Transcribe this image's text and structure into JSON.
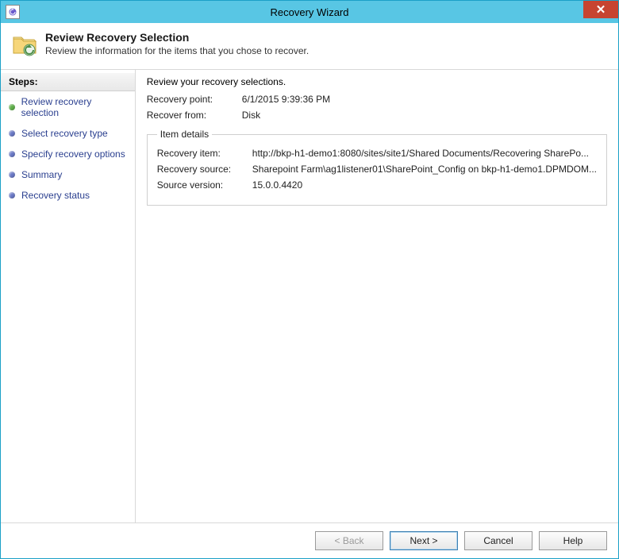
{
  "window": {
    "title": "Recovery Wizard"
  },
  "header": {
    "title": "Review Recovery Selection",
    "subtitle": "Review the information for the items that you chose to recover."
  },
  "sidebar": {
    "title": "Steps:",
    "steps": [
      {
        "label": "Review recovery selection",
        "current": true
      },
      {
        "label": "Select recovery type",
        "current": false
      },
      {
        "label": "Specify recovery options",
        "current": false
      },
      {
        "label": "Summary",
        "current": false
      },
      {
        "label": "Recovery status",
        "current": false
      }
    ]
  },
  "content": {
    "intro": "Review your recovery selections.",
    "recovery_point_label": "Recovery point:",
    "recovery_point_value": "6/1/2015 9:39:36 PM",
    "recover_from_label": "Recover from:",
    "recover_from_value": "Disk",
    "item_details_title": "Item details",
    "recovery_item_label": "Recovery item:",
    "recovery_item_value": "http://bkp-h1-demo1:8080/sites/site1/Shared Documents/Recovering SharePo...",
    "recovery_source_label": "Recovery source:",
    "recovery_source_value": "Sharepoint Farm\\ag1listener01\\SharePoint_Config on bkp-h1-demo1.DPMDOM...",
    "source_version_label": "Source version:",
    "source_version_value": "15.0.0.4420"
  },
  "footer": {
    "back": "< Back",
    "next": "Next >",
    "cancel": "Cancel",
    "help": "Help"
  }
}
